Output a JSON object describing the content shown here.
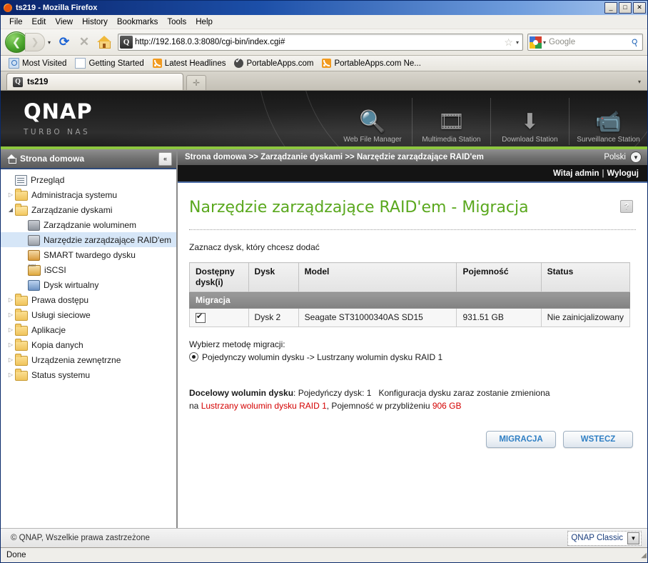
{
  "window": {
    "title": "ts219 - Mozilla Firefox",
    "minimize": "_",
    "maximize": "□",
    "close": "✕"
  },
  "menubar": {
    "items": [
      "File",
      "Edit",
      "View",
      "History",
      "Bookmarks",
      "Tools",
      "Help"
    ]
  },
  "toolbar": {
    "back_glyph": "❮",
    "forward_glyph": "❯",
    "dropdown_glyph": "▾",
    "reload_glyph": "⟳",
    "stop_glyph": "✕",
    "home_name": "home-icon",
    "url": "http://192.168.0.3:8080/cgi-bin/index.cgi#",
    "site_icon_letter": "Q",
    "star_glyph": "☆",
    "caret_glyph": "▾",
    "search_placeholder": "Google",
    "search_value": "",
    "magnifier_glyph": "⚲"
  },
  "bookmarks": [
    {
      "label": "Most Visited",
      "icon": "ico-mv"
    },
    {
      "label": "Getting Started",
      "icon": "ico-page"
    },
    {
      "label": "Latest Headlines",
      "icon": "ico-rss"
    },
    {
      "label": "PortableApps.com",
      "icon": "ico-pa"
    },
    {
      "label": "PortableApps.com Ne...",
      "icon": "ico-rss"
    }
  ],
  "tabs": {
    "active": "ts219",
    "favicon_letter": "Q",
    "new_tab_glyph": "✛",
    "list_glyph": "▾"
  },
  "banner": {
    "logo": "QNAP",
    "sublogo": "TURBO NAS",
    "apps": [
      {
        "label": "Web File Manager",
        "glyph": "🔍",
        "icon_name": "web-file-manager-icon"
      },
      {
        "label": "Multimedia Station",
        "glyph": "🎞",
        "icon_name": "multimedia-station-icon"
      },
      {
        "label": "Download Station",
        "glyph": "⬇",
        "icon_name": "download-station-icon"
      },
      {
        "label": "Surveillance Station",
        "glyph": "📹",
        "icon_name": "surveillance-station-icon"
      }
    ]
  },
  "sidebar": {
    "header": "Strona domowa",
    "collapse_glyph": "«",
    "items": [
      {
        "label": "Przegląd",
        "icon": "doc",
        "level": 0,
        "arrow": "",
        "selected": false
      },
      {
        "label": "Administracja systemu",
        "icon": "folder",
        "level": 0,
        "arrow": "▷",
        "selected": false
      },
      {
        "label": "Zarządzanie dyskami",
        "icon": "folder-open",
        "level": 0,
        "arrow": "◢",
        "selected": false
      },
      {
        "label": "Zarządzanie woluminem",
        "icon": "disk",
        "level": 1,
        "arrow": "",
        "selected": false
      },
      {
        "label": "Narzędzie zarządzające RAID'em",
        "icon": "raid",
        "level": 1,
        "arrow": "",
        "selected": true
      },
      {
        "label": "SMART twardego dysku",
        "icon": "smart",
        "level": 1,
        "arrow": "",
        "selected": false
      },
      {
        "label": "iSCSI",
        "icon": "iscsi",
        "level": 1,
        "arrow": "",
        "selected": false
      },
      {
        "label": "Dysk wirtualny",
        "icon": "vdisk",
        "level": 1,
        "arrow": "",
        "selected": false
      },
      {
        "label": "Prawa dostępu",
        "icon": "folder",
        "level": 0,
        "arrow": "▷",
        "selected": false
      },
      {
        "label": "Usługi sieciowe",
        "icon": "folder",
        "level": 0,
        "arrow": "▷",
        "selected": false
      },
      {
        "label": "Aplikacje",
        "icon": "folder",
        "level": 0,
        "arrow": "▷",
        "selected": false
      },
      {
        "label": "Kopia danych",
        "icon": "folder",
        "level": 0,
        "arrow": "▷",
        "selected": false
      },
      {
        "label": "Urządzenia zewnętrzne",
        "icon": "folder",
        "level": 0,
        "arrow": "▷",
        "selected": false
      },
      {
        "label": "Status systemu",
        "icon": "folder",
        "level": 0,
        "arrow": "▷",
        "selected": false
      }
    ]
  },
  "breadcrumb": {
    "text": "Strona domowa >> Zarządzanie dyskami >> Narzędzie zarządzające RAID'em",
    "language": "Polski",
    "language_arrow": "▼"
  },
  "userbar": {
    "greeting": "Witaj admin",
    "separator": "|",
    "logout": "Wyloguj"
  },
  "main": {
    "title": "Narzędzie zarządzające RAID'em - Migracja",
    "help_glyph": "?",
    "lead": "Zaznacz dysk, który chcesz dodać",
    "table": {
      "caption": "Migracja",
      "columns": [
        "Dostępny dysk(i)",
        "Dysk",
        "Model",
        "Pojemność",
        "Status"
      ],
      "rows": [
        {
          "checked": true,
          "disk": "Dysk 2",
          "model": "Seagate ST31000340AS SD15",
          "capacity": "931.51 GB",
          "status": "Nie zainicjalizowany"
        }
      ]
    },
    "method_label": "Wybierz metodę migracji:",
    "method_option": "Pojedynczy wolumin dysku -> Lustrzany wolumin dysku RAID 1",
    "method_selected": true,
    "summary": {
      "label": "Docelowy wolumin dysku",
      "colon": ": ",
      "current": "Pojedyńczy dysk: 1",
      "note": "Konfiguracja dysku zaraz zostanie zmieniona",
      "line2_prefix": "na ",
      "target_red": "Lustrzany wolumin dysku RAID 1",
      "line2_mid": ", Pojemność w przybliżeniu ",
      "capacity_red": "906 GB"
    },
    "buttons": {
      "primary": "MIGRACJA",
      "secondary": "WSTECZ"
    }
  },
  "footer": {
    "copyright": "© QNAP, Wszelkie prawa zastrzeżone",
    "theme_value": "QNAP Classic",
    "theme_arrow": "▼"
  },
  "statusbar": {
    "text": "Done",
    "grip": "◢"
  },
  "colors": {
    "accent_green": "#8dc63f",
    "title_green": "#5aa81e",
    "alert_red": "#d40000",
    "button_blue": "#2f7fc4",
    "titlebar_blue": "#0a246a"
  }
}
